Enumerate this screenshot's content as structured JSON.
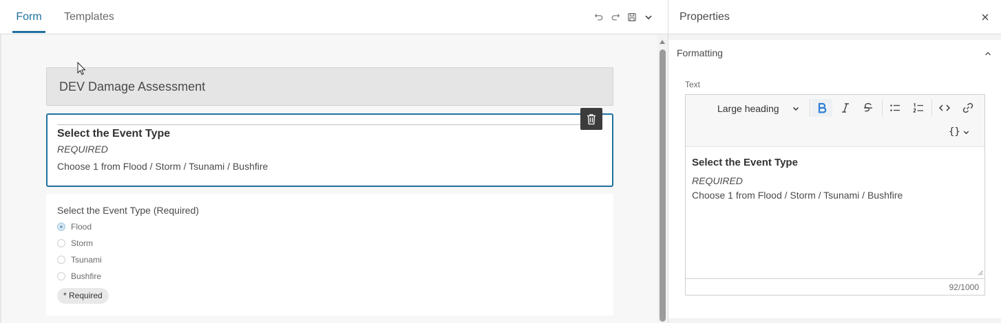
{
  "tabs": [
    {
      "label": "Form",
      "active": true
    },
    {
      "label": "Templates",
      "active": false
    }
  ],
  "toolbar_icons": [
    "undo-icon",
    "redo-icon",
    "save-icon",
    "chevron-down-icon"
  ],
  "form": {
    "title": "DEV Damage Assessment",
    "selected_element": {
      "heading": "Select the Event Type",
      "required_text": "REQUIRED",
      "description": "Choose 1 from Flood / Storm / Tsunami / Bushfire"
    },
    "question": {
      "label": "Select the Event Type (Required)",
      "options": [
        "Flood",
        "Storm",
        "Tsunami",
        "Bushfire"
      ],
      "selected": "Flood",
      "required_badge": "* Required"
    }
  },
  "properties": {
    "title": "Properties",
    "section": "Formatting",
    "field_label": "Text",
    "heading_style": "Large heading",
    "variables_label": "{}",
    "content": {
      "heading": "Select the Event Type",
      "required_text": "REQUIRED",
      "description": "Choose 1 from Flood / Storm / Tsunami / Bushfire"
    },
    "char_count": "92/1000"
  },
  "colors": {
    "accent": "#1f6f9e",
    "bold_active": "#2d7fd3",
    "delete_button": "#3c3c3c"
  }
}
